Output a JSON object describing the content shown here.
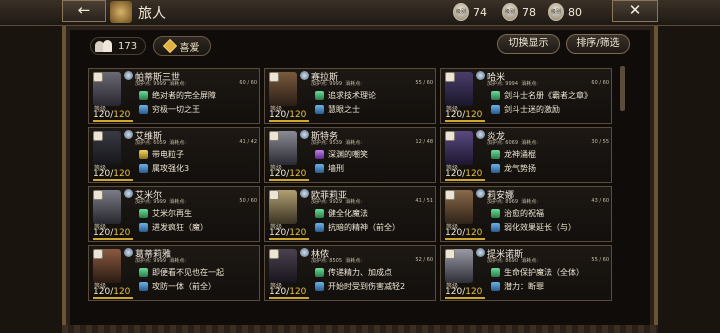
{
  "header": {
    "back_label": "←",
    "title": "旅人",
    "levels": [
      {
        "icon": "级别",
        "value": "74"
      },
      {
        "icon": "级别",
        "value": "78"
      },
      {
        "icon": "级别",
        "value": "80"
      }
    ],
    "close_label": "✕"
  },
  "toolbar": {
    "party_count": "173",
    "favorite_label": "喜爱",
    "switch_label": "切换显示",
    "sort_label": "排序/筛选"
  },
  "labels": {
    "level": "等级",
    "bonus": "加护点",
    "cost": "消耗点"
  },
  "cards": [
    {
      "name": "帕蒂斯三世",
      "bonus": "9999",
      "cost": "60 / 60",
      "level": "120",
      "max": "120",
      "level_pct": 1.0,
      "a1": "绝对者的完全屏障",
      "a1_icon": "ico-green",
      "a2": "穷极一切之王",
      "a2_icon": "ico-blue"
    },
    {
      "name": "赛拉斯",
      "bonus": "9999",
      "cost": "55 / 60",
      "level": "120",
      "max": "120",
      "level_pct": 1.0,
      "a1": "追求技术理论",
      "a1_icon": "ico-green",
      "a2": "慧眼之士",
      "a2_icon": "ico-blue"
    },
    {
      "name": "哈米",
      "bonus": "9994",
      "cost": "60 / 60",
      "level": "120",
      "max": "120",
      "level_pct": 1.0,
      "a1": "剑斗士名册《霸者之章》",
      "a1_icon": "ico-green",
      "a2": "剑斗士迷的激励",
      "a2_icon": "ico-blue"
    },
    {
      "name": "艾维斯",
      "bonus": "6059",
      "cost": "41 / 42",
      "level": "120",
      "max": "120",
      "level_pct": 1.0,
      "a1": "带电粒子",
      "a1_icon": "ico-yellow",
      "a2": "属攻强化3",
      "a2_icon": "ico-blue"
    },
    {
      "name": "斯特务",
      "bonus": "9539",
      "cost": "12 / 48",
      "level": "120",
      "max": "120",
      "level_pct": 1.0,
      "a1": "深渊的嘲笑",
      "a1_icon": "ico-purple",
      "a2": "墙刑",
      "a2_icon": "ico-blue"
    },
    {
      "name": "炎龙",
      "bonus": "6069",
      "cost": "30 / 55",
      "level": "120",
      "max": "120",
      "level_pct": 1.0,
      "a1": "龙神涌棍",
      "a1_icon": "ico-green",
      "a2": "龙气势扬",
      "a2_icon": "ico-blue"
    },
    {
      "name": "艾米尔",
      "bonus": "9999",
      "cost": "50 / 60",
      "level": "120",
      "max": "120",
      "level_pct": 1.0,
      "a1": "艾米尔再生",
      "a1_icon": "ico-green",
      "a2": "进发疯狂（魔）",
      "a2_icon": "ico-blue"
    },
    {
      "name": "欧菲莉亚",
      "bonus": "9929",
      "cost": "41 / 51",
      "level": "120",
      "max": "120",
      "level_pct": 1.0,
      "a1": "健全化魔法",
      "a1_icon": "ico-green",
      "a2": "抗暗的精神（前全）",
      "a2_icon": "ico-blue"
    },
    {
      "name": "莉安娜",
      "bonus": "8969",
      "cost": "43 / 60",
      "level": "120",
      "max": "120",
      "level_pct": 1.0,
      "a1": "治愈的祝福",
      "a1_icon": "ico-green",
      "a2": "弱化效果延长（与）",
      "a2_icon": "ico-blue"
    },
    {
      "name": "葛蒂莉雅",
      "bonus": "9999",
      "cost": "",
      "level": "120",
      "max": "120",
      "level_pct": 1.0,
      "a1": "即便看不见也在一起",
      "a1_icon": "ico-green",
      "a2": "攻防一体（前全）",
      "a2_icon": "ico-blue"
    },
    {
      "name": "林侬",
      "bonus": "8505",
      "cost": "52 / 60",
      "level": "120",
      "max": "120",
      "level_pct": 1.0,
      "a1": "传递精力、加成点",
      "a1_icon": "ico-green",
      "a2": "开始时受到伤害减轻2",
      "a2_icon": "ico-blue"
    },
    {
      "name": "提米诺斯",
      "bonus": "8690",
      "cost": "55 / 60",
      "level": "120",
      "max": "120",
      "level_pct": 1.0,
      "a1": "生命保护魔法（全体）",
      "a1_icon": "ico-green",
      "a2": "潜力：断罪",
      "a2_icon": "ico-blue"
    }
  ]
}
